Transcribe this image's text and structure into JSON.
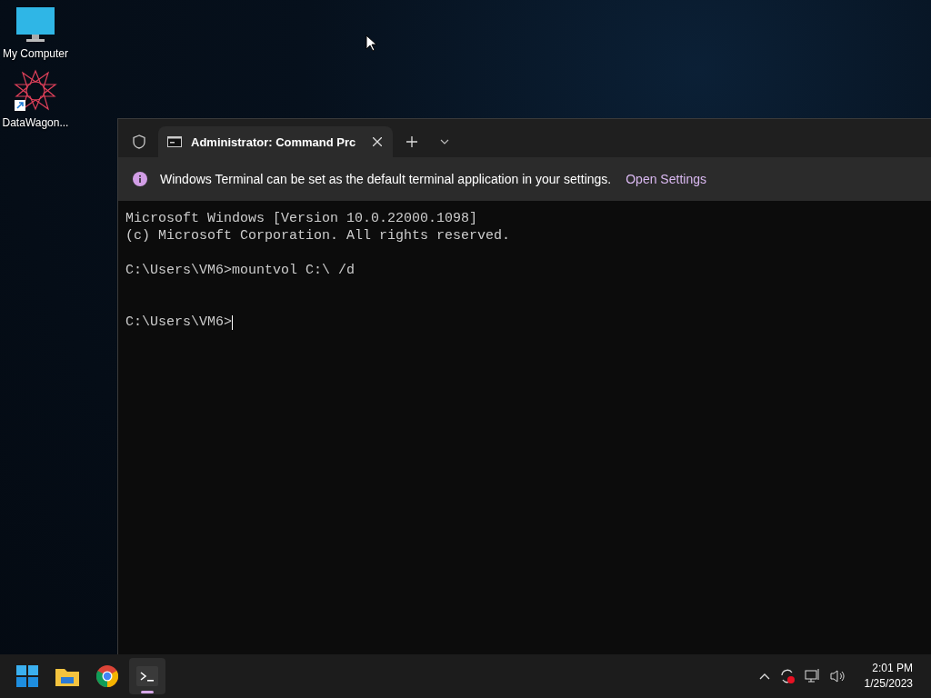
{
  "desktop_icons": [
    {
      "kind": "computer",
      "label": "My Computer"
    },
    {
      "kind": "shortcut",
      "label": "DataWagon..."
    }
  ],
  "terminal": {
    "tab": {
      "title": "Administrator:  Command Prc"
    },
    "infobar": {
      "message": "Windows Terminal can be set as the default terminal application in your settings.",
      "link": "Open Settings"
    },
    "lines": [
      {
        "kind": "output",
        "text": "Microsoft Windows [Version 10.0.22000.1098]"
      },
      {
        "kind": "output",
        "text": "(c) Microsoft Corporation. All rights reserved."
      },
      {
        "kind": "command",
        "text": "C:\\Users\\VM6>mountvol C:\\ /d"
      },
      {
        "kind": "prompt",
        "text": "C:\\Users\\VM6>"
      }
    ]
  },
  "taskbar": {
    "apps": [
      {
        "kind": "start",
        "active": false
      },
      {
        "kind": "explorer",
        "active": false
      },
      {
        "kind": "browser",
        "active": false
      },
      {
        "kind": "terminal",
        "active": true
      }
    ],
    "tray": {
      "time": "2:01 PM",
      "date": "1/25/2023"
    }
  }
}
